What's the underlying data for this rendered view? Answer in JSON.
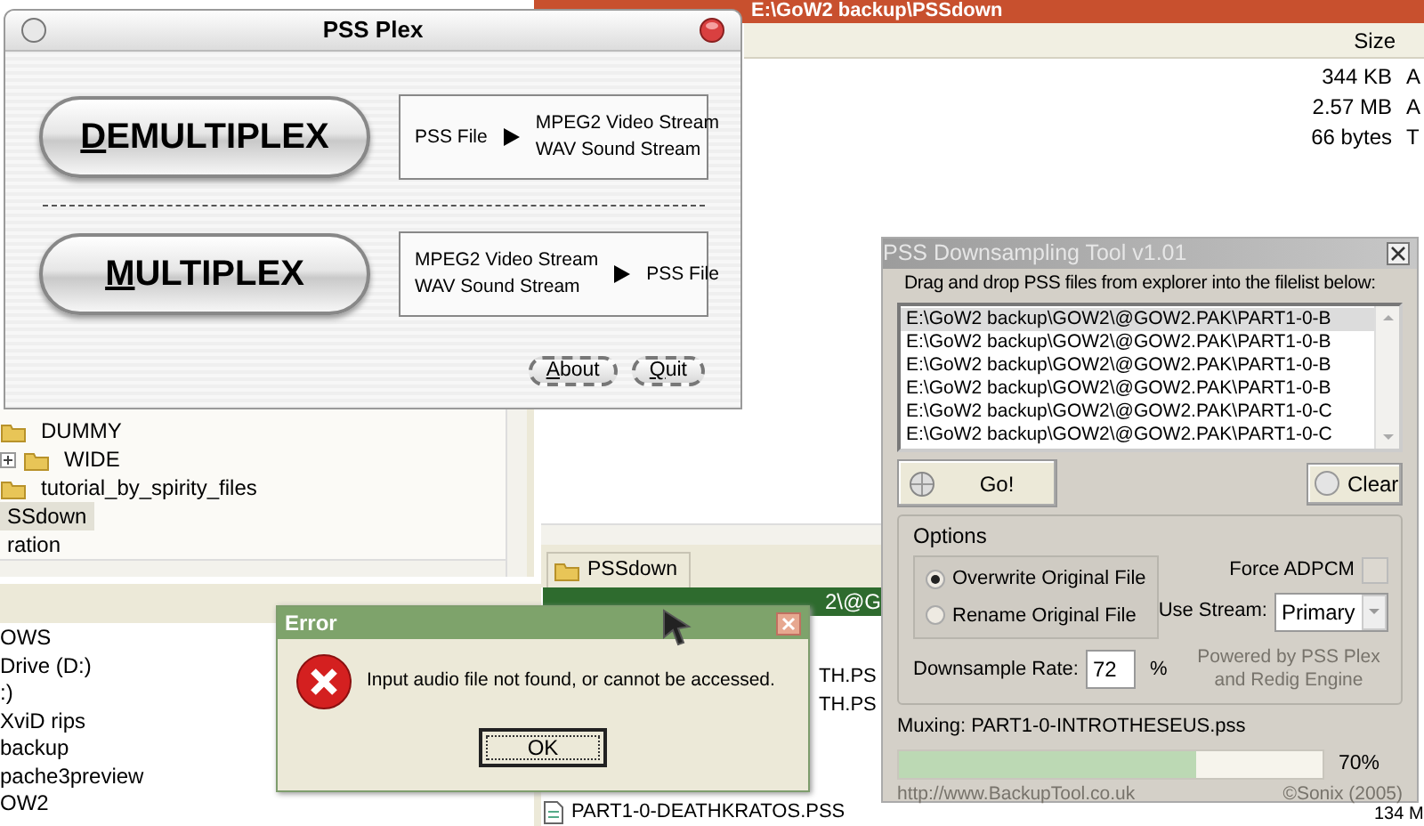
{
  "explorer": {
    "title": "E:\\GoW2 backup\\PSSdown",
    "columns": [
      "Size"
    ],
    "rows": [
      {
        "size": "344 KB",
        "column_2": "A"
      },
      {
        "size": "2.57 MB",
        "column_2": "A"
      },
      {
        "size": "66 bytes",
        "column_2": "T"
      }
    ],
    "folder_tree": [
      {
        "children": [
          {
            "children": [
              {
                "label": "DUMMY",
                "selected": false
              },
              {
                "label": "WIDE",
                "selected": false,
                "expanded": false
              }
            ]
          },
          {
            "label": "tutorial_by_spirity_files",
            "selected": false
          }
        ]
      },
      {
        "label": "SSdown",
        "selected": true
      },
      {
        "label": "ration",
        "selected": false
      }
    ],
    "drive_tree": [
      "OWS",
      "Drive (D:)",
      ":)",
      "XviD rips",
      "backup",
      "pache3preview",
      "OW2"
    ],
    "tab": "PSSdown",
    "path_bar": "2\\@G",
    "files": [
      "TH.PS",
      "TH.PS",
      "PART1-0-DEATHKRATOS.PSS"
    ],
    "size_fragment": "134 M"
  },
  "pss_plex": {
    "title": "PSS Plex",
    "actions": [
      {
        "label": "DEMULTIPLEX",
        "inputs": [
          "PSS File"
        ],
        "outputs": [
          "MPEG2 Video Stream",
          "WAV Sound Stream"
        ]
      },
      {
        "label": "MULTIPLEX",
        "inputs": [
          "MPEG2 Video Stream",
          "WAV Sound Stream"
        ],
        "outputs": [
          "PSS File"
        ]
      }
    ],
    "buttons": [
      "About",
      "Quit"
    ]
  },
  "error_dialog": {
    "title": "Error",
    "message": "Input audio file not found, or cannot be accessed.",
    "button": "OK"
  },
  "downsampler": {
    "title": "PSS Downsampling Tool v1.01",
    "instruction": "Drag and drop PSS files from explorer into the filelist below:",
    "files": [
      {
        "path": "E:\\GoW2 backup\\GOW2\\@GOW2.PAK\\PART1-0-B",
        "selected": true
      },
      {
        "path": "E:\\GoW2 backup\\GOW2\\@GOW2.PAK\\PART1-0-B",
        "selected": false
      },
      {
        "path": "E:\\GoW2 backup\\GOW2\\@GOW2.PAK\\PART1-0-B",
        "selected": false
      },
      {
        "path": "E:\\GoW2 backup\\GOW2\\@GOW2.PAK\\PART1-0-B",
        "selected": false
      },
      {
        "path": "E:\\GoW2 backup\\GOW2\\@GOW2.PAK\\PART1-0-C",
        "selected": false
      },
      {
        "path": "E:\\GoW2 backup\\GOW2\\@GOW2.PAK\\PART1-0-C",
        "selected": false
      }
    ],
    "go_button": "Go!",
    "clear_button": "Clear",
    "options_title": "Options",
    "modes": [
      {
        "label": "Overwrite Original File",
        "selected": true
      },
      {
        "label": "Rename Original File",
        "selected": false
      }
    ],
    "force_adpcm": {
      "label": "Force ADPCM",
      "checked": false
    },
    "stream": {
      "label": "Use Stream:",
      "value": "Primary"
    },
    "rate": {
      "label": "Downsample Rate:",
      "value": "72",
      "unit": "%"
    },
    "powered_by": "Powered by PSS Plex and Redig Engine",
    "status": "Muxing: PART1-0-INTROTHESEUS.pss",
    "progress": {
      "level": 0.7,
      "reading": "70%"
    },
    "url": "http://www.BackupTool.co.uk",
    "copyright": "©Sonix (2005)"
  }
}
